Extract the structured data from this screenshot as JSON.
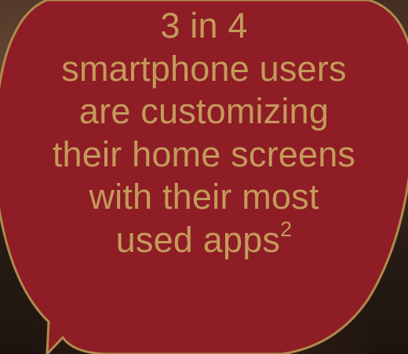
{
  "stat_bubble": {
    "lines": [
      "3 in 4",
      "smartphone users",
      "are customizing",
      "their home screens",
      "with their most"
    ],
    "last_line_text": "used apps",
    "footnote_marker": "2"
  },
  "colors": {
    "bubble_fill": "#8e1d26",
    "bubble_border": "#b08a4a",
    "text": "#c49a5a",
    "background": "#2a1a12"
  }
}
